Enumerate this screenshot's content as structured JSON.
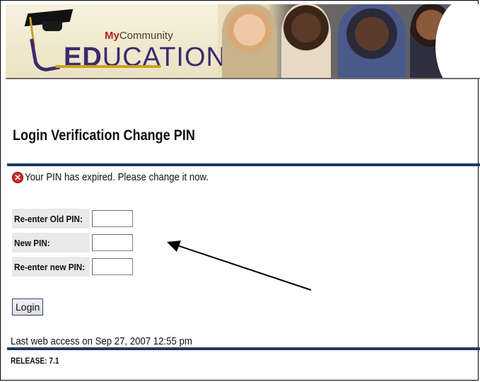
{
  "banner": {
    "brand_prefix": "My",
    "brand_suffix": "Community",
    "logo_bold": "ED",
    "logo_rest": "UCATION"
  },
  "page": {
    "title": "Login Verification Change PIN"
  },
  "message": {
    "icon": "error-x-icon",
    "text": "Your PIN has expired. Please change it now."
  },
  "form": {
    "old_pin_label": "Re-enter Old PIN:",
    "new_pin_label": "New PIN:",
    "confirm_pin_label": "Re-enter new PIN:",
    "old_pin_value": "",
    "new_pin_value": "",
    "confirm_pin_value": "",
    "submit_label": "Login"
  },
  "footer": {
    "last_access": "Last web access on Sep 27, 2007 12:55 pm",
    "release": "RELEASE: 7.1"
  },
  "colors": {
    "rule": "#1f3a5f",
    "error": "#d02828",
    "brand_purple": "#3b2a6e",
    "brand_red": "#b22222"
  }
}
